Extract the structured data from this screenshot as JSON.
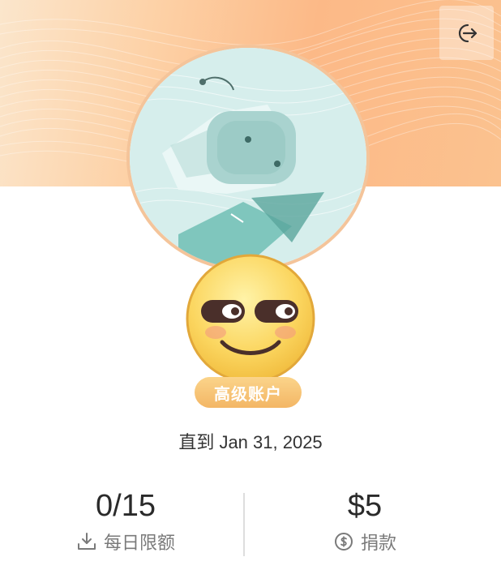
{
  "header": {
    "logout_icon": "logout-icon"
  },
  "profile": {
    "avatar_icon": "robot-reading-avatar",
    "tier_emoji": "smirking-face-emoji",
    "tier_badge": "高级账户",
    "expiry_text": "直到 Jan 31, 2025"
  },
  "stats": {
    "daily_limit": {
      "value": "0/15",
      "label": "每日限额",
      "icon": "download-icon"
    },
    "donation": {
      "value": "$5",
      "label": "捐款",
      "icon": "dollar-circle-icon"
    }
  },
  "colors": {
    "banner": "#fcb987",
    "badge": "#f3b665",
    "avatar_bg": "#cfe9e8",
    "ring": "#f4c49a"
  }
}
